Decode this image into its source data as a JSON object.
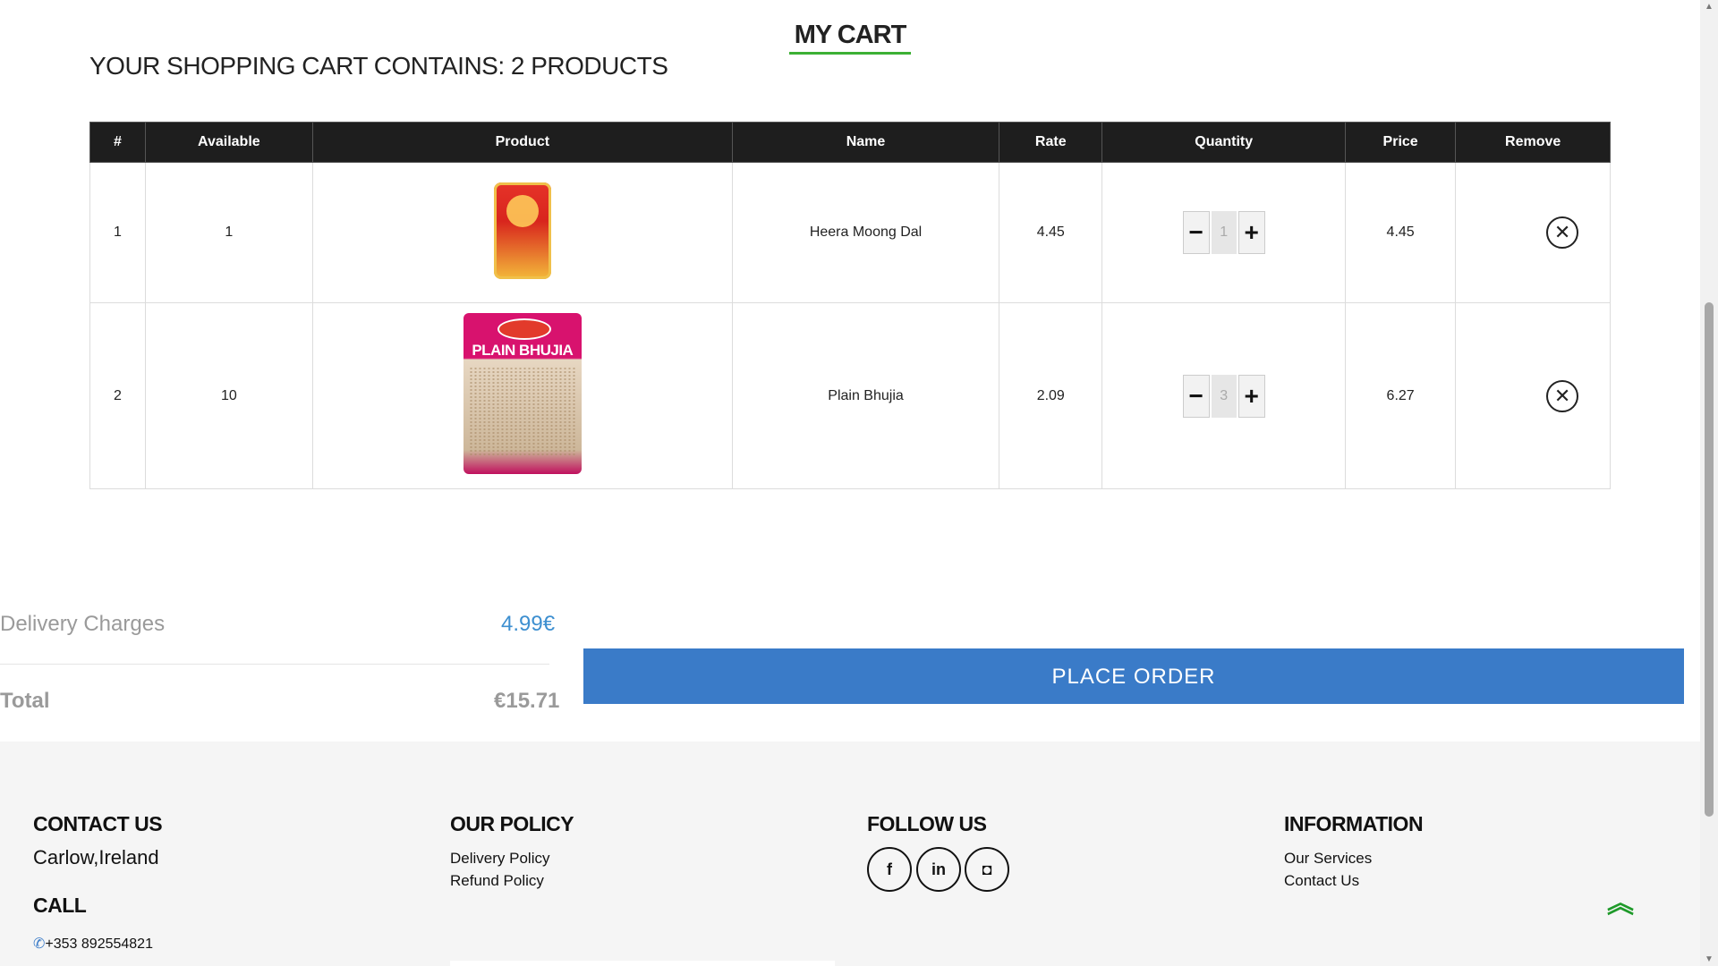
{
  "page": {
    "title": "MY CART",
    "summary": "YOUR SHOPPING CART CONTAINS: 2 PRODUCTS"
  },
  "table": {
    "headers": [
      "#",
      "Available",
      "Product",
      "Name",
      "Rate",
      "Quantity",
      "Price",
      "Remove"
    ],
    "rows": [
      {
        "index": "1",
        "available": "1",
        "product_image": "heera-moong-dal-pack",
        "name": "Heera Moong Dal",
        "rate": "4.45",
        "quantity": "1",
        "price": "4.45"
      },
      {
        "index": "2",
        "available": "10",
        "product_image": "plain-bhujia-pack",
        "name": "Plain Bhujia",
        "rate": "2.09",
        "quantity": "3",
        "price": "6.27"
      }
    ],
    "minus_icon": "minus-icon",
    "plus_icon": "plus-icon",
    "remove_icon": "close-circle-icon"
  },
  "totals": {
    "delivery_label": "Delivery Charges",
    "delivery_value": "4.99€",
    "total_label": "Total",
    "total_value": "€15.71"
  },
  "place_order_label": "PLACE ORDER",
  "footer": {
    "contact_heading": "CONTACT US",
    "contact_address": "Carlow,Ireland",
    "call_heading": "CALL",
    "phone": "+353 892554821",
    "policy_heading": "OUR POLICY",
    "policy_links": [
      "Delivery Policy",
      "Refund Policy"
    ],
    "follow_heading": "FOLLOW US",
    "social": [
      {
        "icon": "facebook-icon",
        "glyph": "f"
      },
      {
        "icon": "linkedin-icon",
        "glyph": "in"
      },
      {
        "icon": "instagram-icon",
        "glyph": "◘"
      }
    ],
    "info_heading": "INFORMATION",
    "info_links": [
      "Our Services",
      "Contact Us"
    ]
  },
  "colors": {
    "accent_green": "#3cb034",
    "button_blue": "#3a7bc8",
    "header_dark": "#1e1e1e",
    "delivery_blue": "#3d8fd0"
  }
}
